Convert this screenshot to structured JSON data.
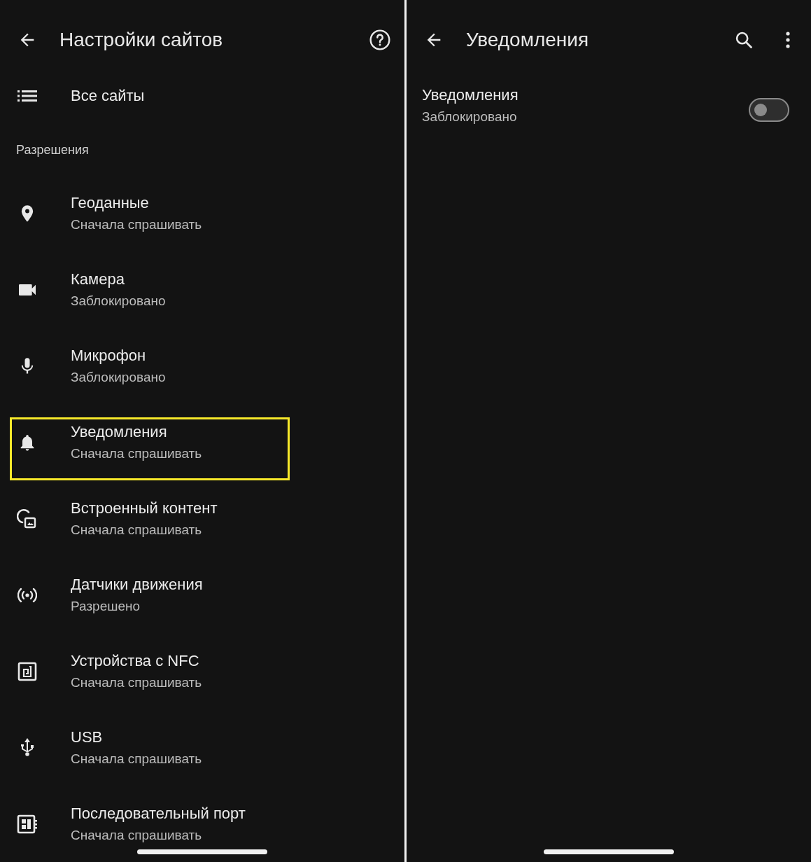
{
  "left_panel": {
    "header": {
      "title": "Настройки сайтов"
    },
    "all_sites": {
      "label": "Все сайты"
    },
    "permissions": {
      "heading": "Разрешения",
      "items": [
        {
          "kind": "location",
          "title": "Геоданные",
          "status": "Сначала спрашивать",
          "highlighted": false
        },
        {
          "kind": "camera",
          "title": "Камера",
          "status": "Заблокировано",
          "highlighted": false
        },
        {
          "kind": "microphone",
          "title": "Микрофон",
          "status": "Заблокировано",
          "highlighted": false
        },
        {
          "kind": "bell",
          "title": "Уведомления",
          "status": "Сначала спрашивать",
          "highlighted": true
        },
        {
          "kind": "embedded",
          "title": "Встроенный контент",
          "status": "Сначала спрашивать",
          "highlighted": false
        },
        {
          "kind": "motion",
          "title": "Датчики движения",
          "status": "Разрешено",
          "highlighted": false
        },
        {
          "kind": "nfc",
          "title": "Устройства с NFC",
          "status": "Сначала спрашивать",
          "highlighted": false
        },
        {
          "kind": "usb",
          "title": "USB",
          "status": "Сначала спрашивать",
          "highlighted": false
        },
        {
          "kind": "serial",
          "title": "Последовательный порт",
          "status": "Сначала спрашивать",
          "highlighted": false
        }
      ]
    }
  },
  "right_panel": {
    "header": {
      "title": "Уведомления"
    },
    "setting": {
      "title": "Уведомления",
      "status": "Заблокировано",
      "on": false
    }
  }
}
